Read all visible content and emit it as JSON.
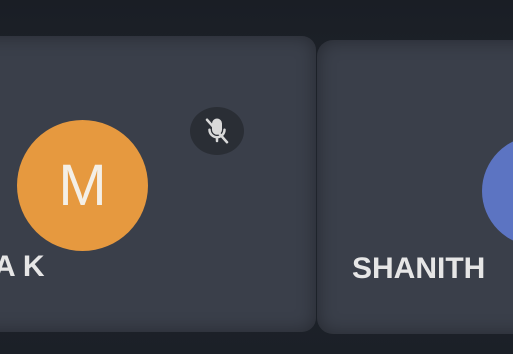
{
  "participants": [
    {
      "name": "A K",
      "avatar_initial": "M",
      "avatar_color": "#e6993f",
      "muted": true,
      "mute_icon": "mic-off-icon"
    },
    {
      "name": "SHANITH",
      "avatar_initial": "",
      "avatar_color": "#5c74c2"
    }
  ],
  "tile_color": "#3a3f4a",
  "background_color": "#1d2229"
}
